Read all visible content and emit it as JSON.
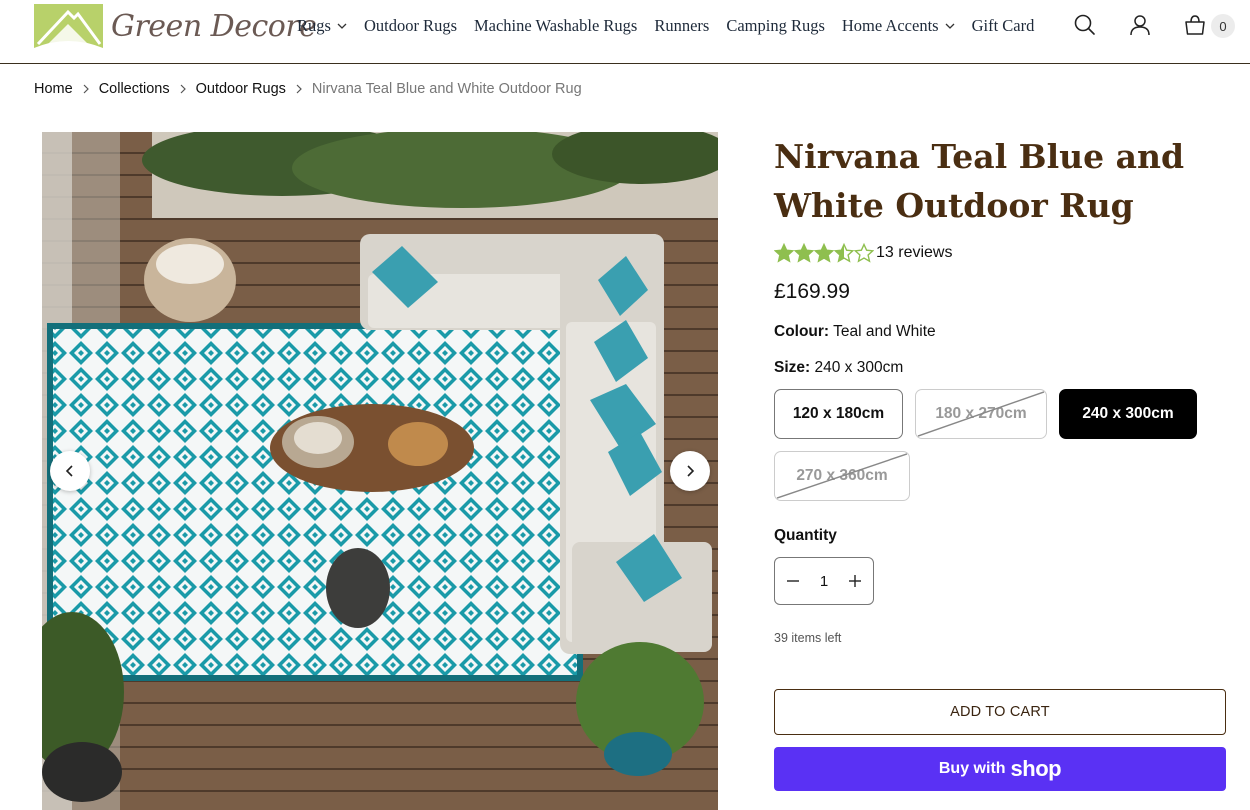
{
  "brand": {
    "name": "Green Decore",
    "logo_icon": "house-roof-logo",
    "accent": "#b8d16a"
  },
  "nav": {
    "items": [
      {
        "label": "Rugs",
        "has_dropdown": true
      },
      {
        "label": "Outdoor Rugs",
        "has_dropdown": false
      },
      {
        "label": "Machine Washable Rugs",
        "has_dropdown": false
      },
      {
        "label": "Runners",
        "has_dropdown": false
      },
      {
        "label": "Camping Rugs",
        "has_dropdown": false
      },
      {
        "label": "Home Accents",
        "has_dropdown": true
      },
      {
        "label": "Gift Card",
        "has_dropdown": false
      }
    ],
    "icons": [
      "search-icon",
      "account-icon",
      "cart-icon"
    ],
    "cart_count": "0"
  },
  "breadcrumb": {
    "items": [
      "Home",
      "Collections",
      "Outdoor Rugs",
      "Nirvana Teal Blue and White Outdoor Rug"
    ]
  },
  "product": {
    "title": "Nirvana Teal Blue and White Outdoor Rug",
    "rating": 3.5,
    "rating_max": 5,
    "reviews_label": "13 reviews",
    "price": "£169.99",
    "colour_label": "Colour:",
    "colour_value": "Teal and White",
    "size_label": "Size:",
    "size_value": "240 x 300cm",
    "sizes": [
      {
        "label": "120 x 180cm",
        "state": "available"
      },
      {
        "label": "180 x 270cm",
        "state": "unavailable"
      },
      {
        "label": "240 x 300cm",
        "state": "selected"
      },
      {
        "label": "270 x 360cm",
        "state": "unavailable"
      }
    ],
    "quantity_label": "Quantity",
    "quantity": "1",
    "stock_text": "39 items left",
    "add_to_cart": "ADD TO CART",
    "buy_with": "Buy with",
    "buy_brand": "shop"
  },
  "colors": {
    "title": "#4a2e12",
    "star": "#8fbf4f",
    "rug_teal": "#1a9aa8",
    "buy_button": "#5a31f4"
  }
}
